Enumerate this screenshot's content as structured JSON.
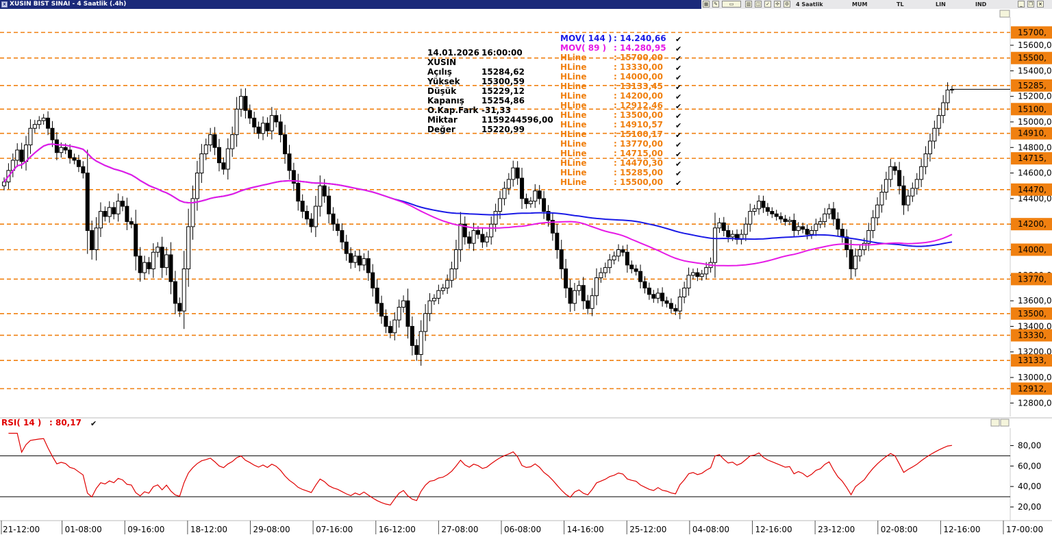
{
  "window": {
    "title": "XUSIN BIST SINAI - 4 Saatlik (.4h)",
    "toolbar": {
      "period_label": "4 Saatlik",
      "chart_type": "MUM",
      "currency": "TL",
      "scale": "LIN",
      "indicator": "IND"
    }
  },
  "info_box": {
    "date": "14.01.2026",
    "time": "16:00:00",
    "symbol": "XUSIN",
    "rows": [
      {
        "label": "Açılış",
        "value": "15284,62"
      },
      {
        "label": "Yüksek",
        "value": "15300,59"
      },
      {
        "label": "Düşük",
        "value": "15229,12"
      },
      {
        "label": "Kapanış",
        "value": "15254,86"
      },
      {
        "label": "O.Kap.Fark",
        "value": "-31,33"
      },
      {
        "label": "Miktar",
        "value": "1159244596,00"
      },
      {
        "label": "Değer",
        "value": "15220,99"
      }
    ]
  },
  "overlay_legend": [
    {
      "label": "MOV( 144 )",
      "value": ": 14.240,66",
      "color": "#1a1ae6"
    },
    {
      "label": "MOV( 89 )",
      "value": ": 14.280,95",
      "color": "#e61ae6"
    },
    {
      "label": "HLine",
      "value": ": 15700,00",
      "color": "#f08010"
    },
    {
      "label": "HLine",
      "value": ": 13330,00",
      "color": "#f08010"
    },
    {
      "label": "HLine",
      "value": ": 14000,00",
      "color": "#f08010"
    },
    {
      "label": "HLine",
      "value": ": 13133,45",
      "color": "#f08010"
    },
    {
      "label": "HLine",
      "value": ": 14200,00",
      "color": "#f08010"
    },
    {
      "label": "HLine",
      "value": ": 12912,46",
      "color": "#f08010"
    },
    {
      "label": "HLine",
      "value": ": 13500,00",
      "color": "#f08010"
    },
    {
      "label": "HLine",
      "value": ": 14910,57",
      "color": "#f08010"
    },
    {
      "label": "HLine",
      "value": ": 15100,17",
      "color": "#f08010"
    },
    {
      "label": "HLine",
      "value": ": 13770,00",
      "color": "#f08010"
    },
    {
      "label": "HLine",
      "value": ": 14715,00",
      "color": "#f08010"
    },
    {
      "label": "HLine",
      "value": ": 14470,30",
      "color": "#f08010"
    },
    {
      "label": "HLine",
      "value": ": 15285,00",
      "color": "#f08010"
    },
    {
      "label": "HLine",
      "value": ": 15500,00",
      "color": "#f08010"
    }
  ],
  "rsi_legend": {
    "label": "RSI( 14 )",
    "value": ": 80,17",
    "color": "#e00000"
  },
  "chart_data": [
    {
      "type": "candlestick",
      "title": "XUSIN BIST SINAI - 4 Saatlik (.4h)",
      "ylim": [
        12700,
        15820
      ],
      "y_ticks": [
        12800,
        13000,
        13200,
        13400,
        13600,
        13800,
        14000,
        14200,
        14400,
        14600,
        14800,
        15000,
        15200,
        15400,
        15600
      ],
      "y_tick_labels": [
        "12800,0",
        "13000,0",
        "13200,0",
        "13400,0",
        "13600,0",
        "13800,0",
        "14000,0",
        "14200,0",
        "14400,0",
        "14600,0",
        "14800,0",
        "15000,0",
        "15200,0",
        "15400,0",
        "15600,0"
      ],
      "x_tick_labels": [
        "21-12:00",
        "01-08:00",
        "09-16:00",
        "18-12:00",
        "29-08:00",
        "07-16:00",
        "16-12:00",
        "27-08:00",
        "06-08:00",
        "14-16:00",
        "25-12:00",
        "04-08:00",
        "12-16:00",
        "23-12:00",
        "02-08:00",
        "12-16:00",
        "17-00:00"
      ],
      "last_close": 15254.86,
      "hlines": [
        {
          "value": 15700.0,
          "label": "15700,"
        },
        {
          "value": 15500.0,
          "label": "15500,"
        },
        {
          "value": 15285.0,
          "label": "15285,"
        },
        {
          "value": 15100.17,
          "label": "15100,"
        },
        {
          "value": 14910.57,
          "label": "14910,"
        },
        {
          "value": 14715.0,
          "label": "14715,"
        },
        {
          "value": 14470.3,
          "label": "14470,"
        },
        {
          "value": 14200.0,
          "label": "14200,"
        },
        {
          "value": 14000.0,
          "label": "14000,"
        },
        {
          "value": 13770.0,
          "label": "13770,"
        },
        {
          "value": 13500.0,
          "label": "13500,"
        },
        {
          "value": 13330.0,
          "label": "13330,"
        },
        {
          "value": 13133.45,
          "label": "13133,"
        },
        {
          "value": 12912.46,
          "label": "12912,"
        }
      ],
      "close_series": [
        14530,
        14620,
        14700,
        14780,
        14690,
        14820,
        14950,
        14980,
        15010,
        15030,
        14950,
        14860,
        14760,
        14800,
        14780,
        14720,
        14700,
        14650,
        14600,
        14150,
        14000,
        14170,
        14300,
        14260,
        14330,
        14280,
        14380,
        14340,
        14220,
        14200,
        13950,
        13820,
        13900,
        13850,
        13980,
        14020,
        13860,
        13960,
        13750,
        13580,
        13520,
        13850,
        14180,
        14400,
        14600,
        14750,
        14820,
        14900,
        14800,
        14680,
        14630,
        14790,
        14900,
        15100,
        15200,
        15090,
        15030,
        14960,
        14910,
        14990,
        14930,
        15050,
        15000,
        14900,
        14750,
        14620,
        14520,
        14380,
        14300,
        14240,
        14180,
        14340,
        14500,
        14420,
        14280,
        14200,
        14150,
        14060,
        13970,
        13900,
        13950,
        13880,
        13930,
        13820,
        13700,
        13580,
        13480,
        13400,
        13350,
        13450,
        13550,
        13600,
        13400,
        13250,
        13180,
        13360,
        13500,
        13600,
        13620,
        13680,
        13700,
        13760,
        13850,
        14000,
        14200,
        14100,
        14050,
        14150,
        14120,
        14060,
        14100,
        14200,
        14300,
        14400,
        14480,
        14550,
        14640,
        14560,
        14400,
        14360,
        14380,
        14460,
        14400,
        14300,
        14230,
        14130,
        14000,
        13850,
        13700,
        13580,
        13680,
        13720,
        13600,
        13540,
        13640,
        13780,
        13820,
        13860,
        13920,
        13950,
        14000,
        13980,
        13880,
        13850,
        13830,
        13750,
        13700,
        13650,
        13620,
        13660,
        13600,
        13580,
        13540,
        13520,
        13630,
        13700,
        13800,
        13820,
        13790,
        13810,
        13860,
        13900,
        14170,
        14210,
        14150,
        14100,
        14120,
        14080,
        14120,
        14200,
        14300,
        14320,
        14380,
        14330,
        14300,
        14280,
        14260,
        14240,
        14220,
        14230,
        14150,
        14180,
        14160,
        14120,
        14150,
        14200,
        14220,
        14280,
        14320,
        14240,
        14160,
        14100,
        14000,
        13850,
        13950,
        14000,
        14050,
        14150,
        14250,
        14350,
        14450,
        14550,
        14650,
        14620,
        14500,
        14350,
        14420,
        14480,
        14550,
        14650,
        14750,
        14850,
        14950,
        15050,
        15150,
        15250,
        15255
      ]
    },
    {
      "type": "line",
      "title": "RSI( 14 )",
      "ylim": [
        10,
        95
      ],
      "y_ticks": [
        20,
        40,
        60,
        80
      ],
      "y_tick_labels": [
        "20,00",
        "40,00",
        "60,00",
        "80,00"
      ],
      "reference_lines": [
        30,
        70
      ],
      "last_value": 80.17
    }
  ]
}
